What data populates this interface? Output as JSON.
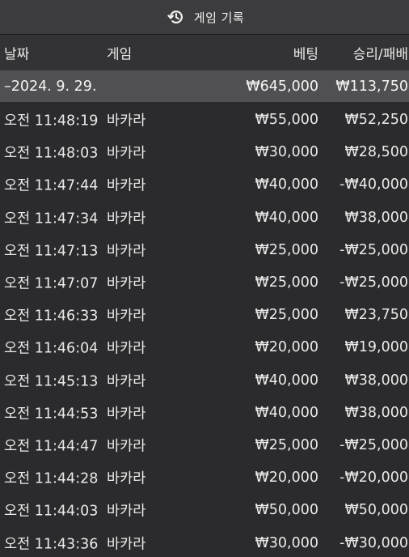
{
  "title_bar": {
    "title": "게임 기록",
    "icon": "history-icon"
  },
  "table": {
    "headers": {
      "date": "날짜",
      "game": "게임",
      "bet": "베팅",
      "result": "승리/패배"
    },
    "summary": {
      "date": "–2024. 9. 29.",
      "game": "",
      "bet": "₩645,000",
      "result": "₩113,750"
    },
    "rows": [
      {
        "date": "오전 11:48:19",
        "game": "바카라",
        "bet": "₩55,000",
        "result": "₩52,250"
      },
      {
        "date": "오전 11:48:03",
        "game": "바카라",
        "bet": "₩30,000",
        "result": "₩28,500"
      },
      {
        "date": "오전 11:47:44",
        "game": "바카라",
        "bet": "₩40,000",
        "result": "-₩40,000"
      },
      {
        "date": "오전 11:47:34",
        "game": "바카라",
        "bet": "₩40,000",
        "result": "₩38,000"
      },
      {
        "date": "오전 11:47:13",
        "game": "바카라",
        "bet": "₩25,000",
        "result": "-₩25,000"
      },
      {
        "date": "오전 11:47:07",
        "game": "바카라",
        "bet": "₩25,000",
        "result": "-₩25,000"
      },
      {
        "date": "오전 11:46:33",
        "game": "바카라",
        "bet": "₩25,000",
        "result": "₩23,750"
      },
      {
        "date": "오전 11:46:04",
        "game": "바카라",
        "bet": "₩20,000",
        "result": "₩19,000"
      },
      {
        "date": "오전 11:45:13",
        "game": "바카라",
        "bet": "₩40,000",
        "result": "₩38,000"
      },
      {
        "date": "오전 11:44:53",
        "game": "바카라",
        "bet": "₩40,000",
        "result": "₩38,000"
      },
      {
        "date": "오전 11:44:47",
        "game": "바카라",
        "bet": "₩25,000",
        "result": "-₩25,000"
      },
      {
        "date": "오전 11:44:28",
        "game": "바카라",
        "bet": "₩20,000",
        "result": "-₩20,000"
      },
      {
        "date": "오전 11:44:03",
        "game": "바카라",
        "bet": "₩50,000",
        "result": "₩50,000"
      },
      {
        "date": "오전 11:43:36",
        "game": "바카라",
        "bet": "₩30,000",
        "result": "-₩30,000"
      }
    ]
  }
}
